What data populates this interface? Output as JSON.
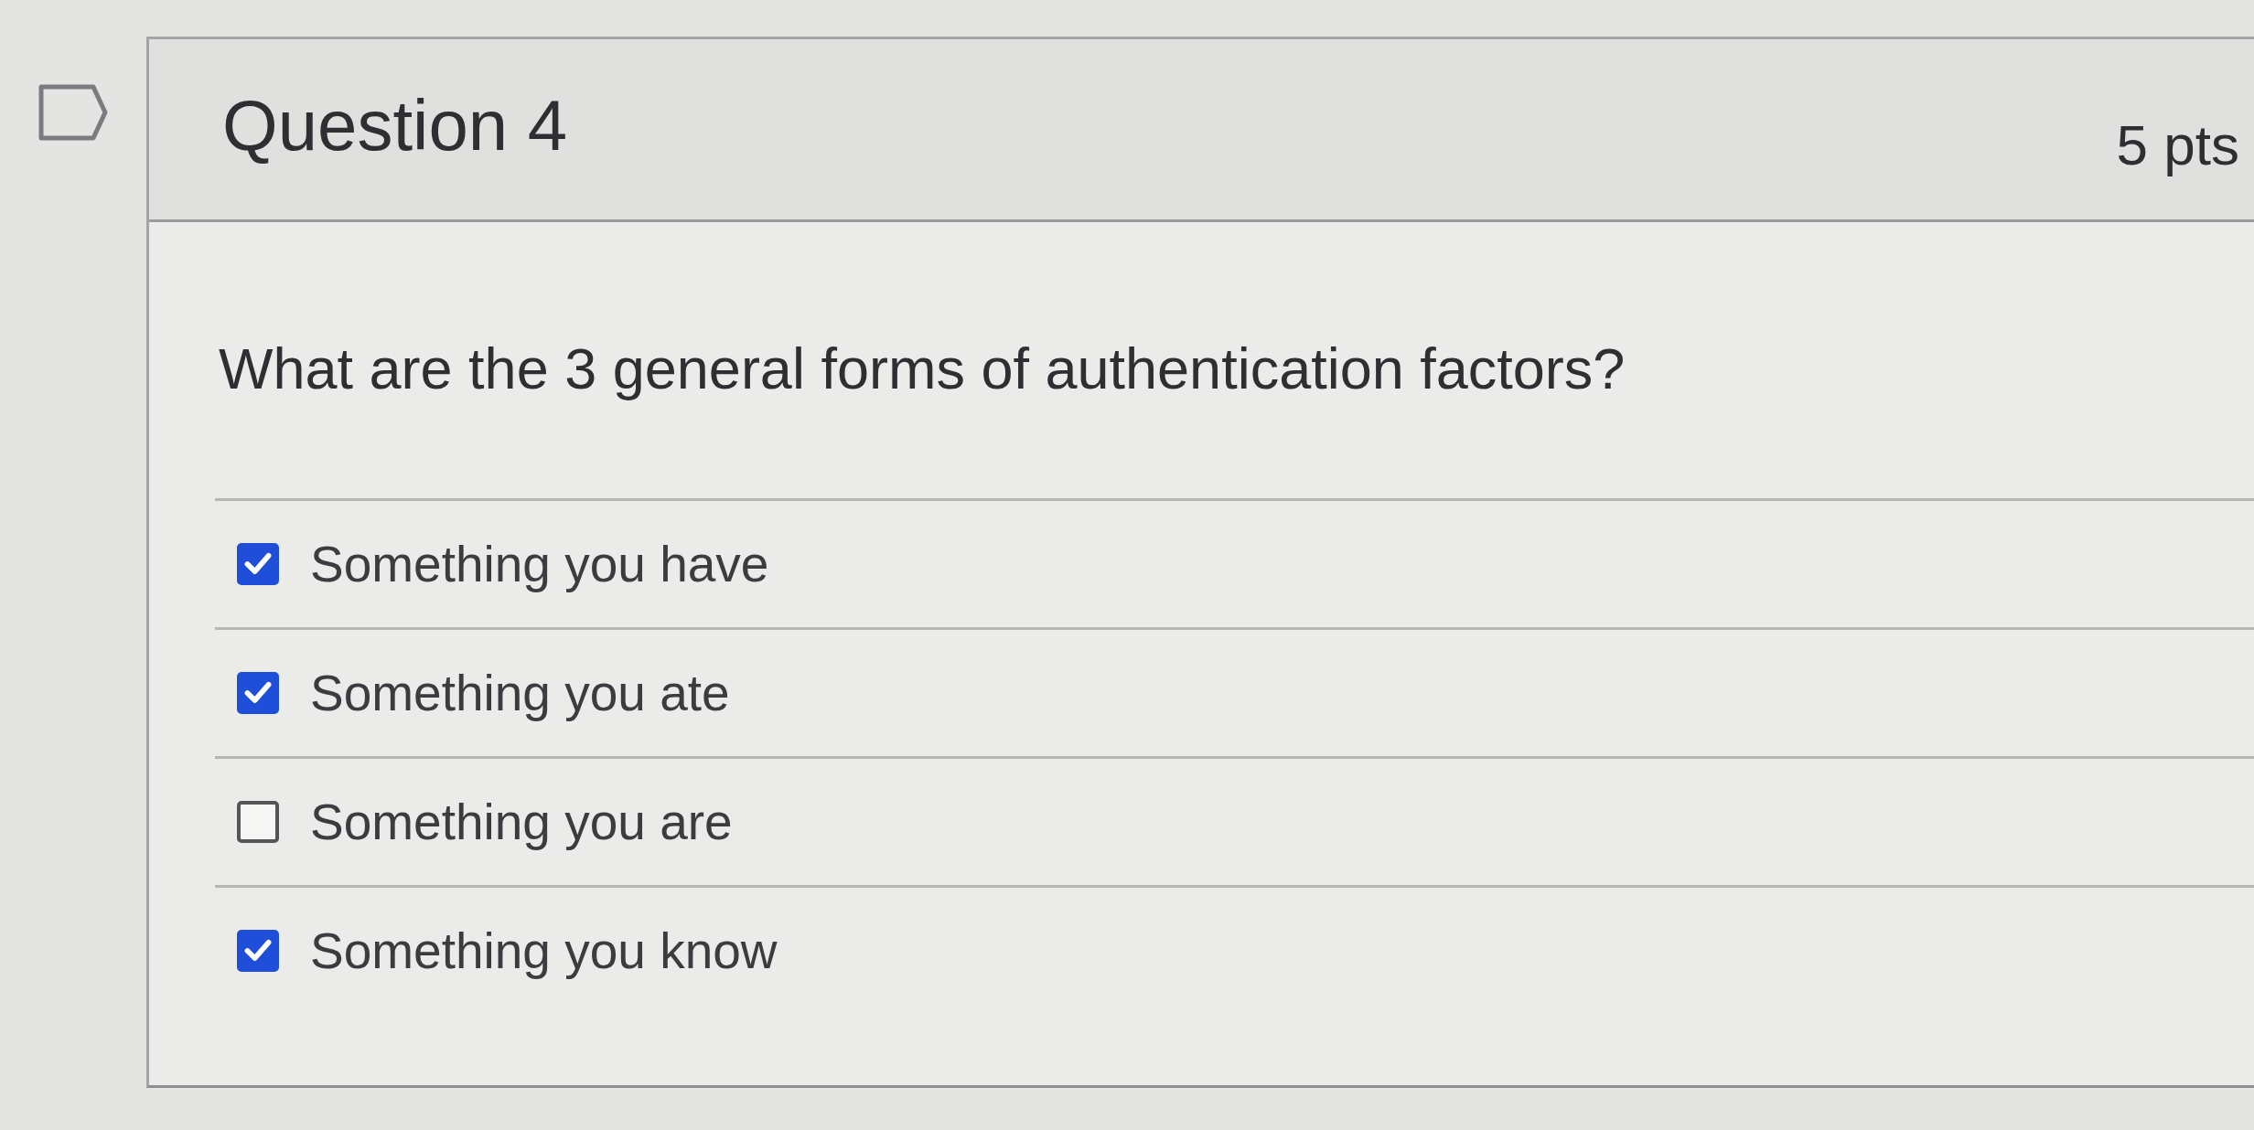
{
  "question": {
    "title": "Question 4",
    "points": "5 pts",
    "text": "What are the 3 general forms of authentication factors?",
    "answers": [
      {
        "label": "Something you have",
        "checked": true
      },
      {
        "label": "Something you ate",
        "checked": true
      },
      {
        "label": "Something you are",
        "checked": false
      },
      {
        "label": "Something you know",
        "checked": true
      }
    ]
  }
}
